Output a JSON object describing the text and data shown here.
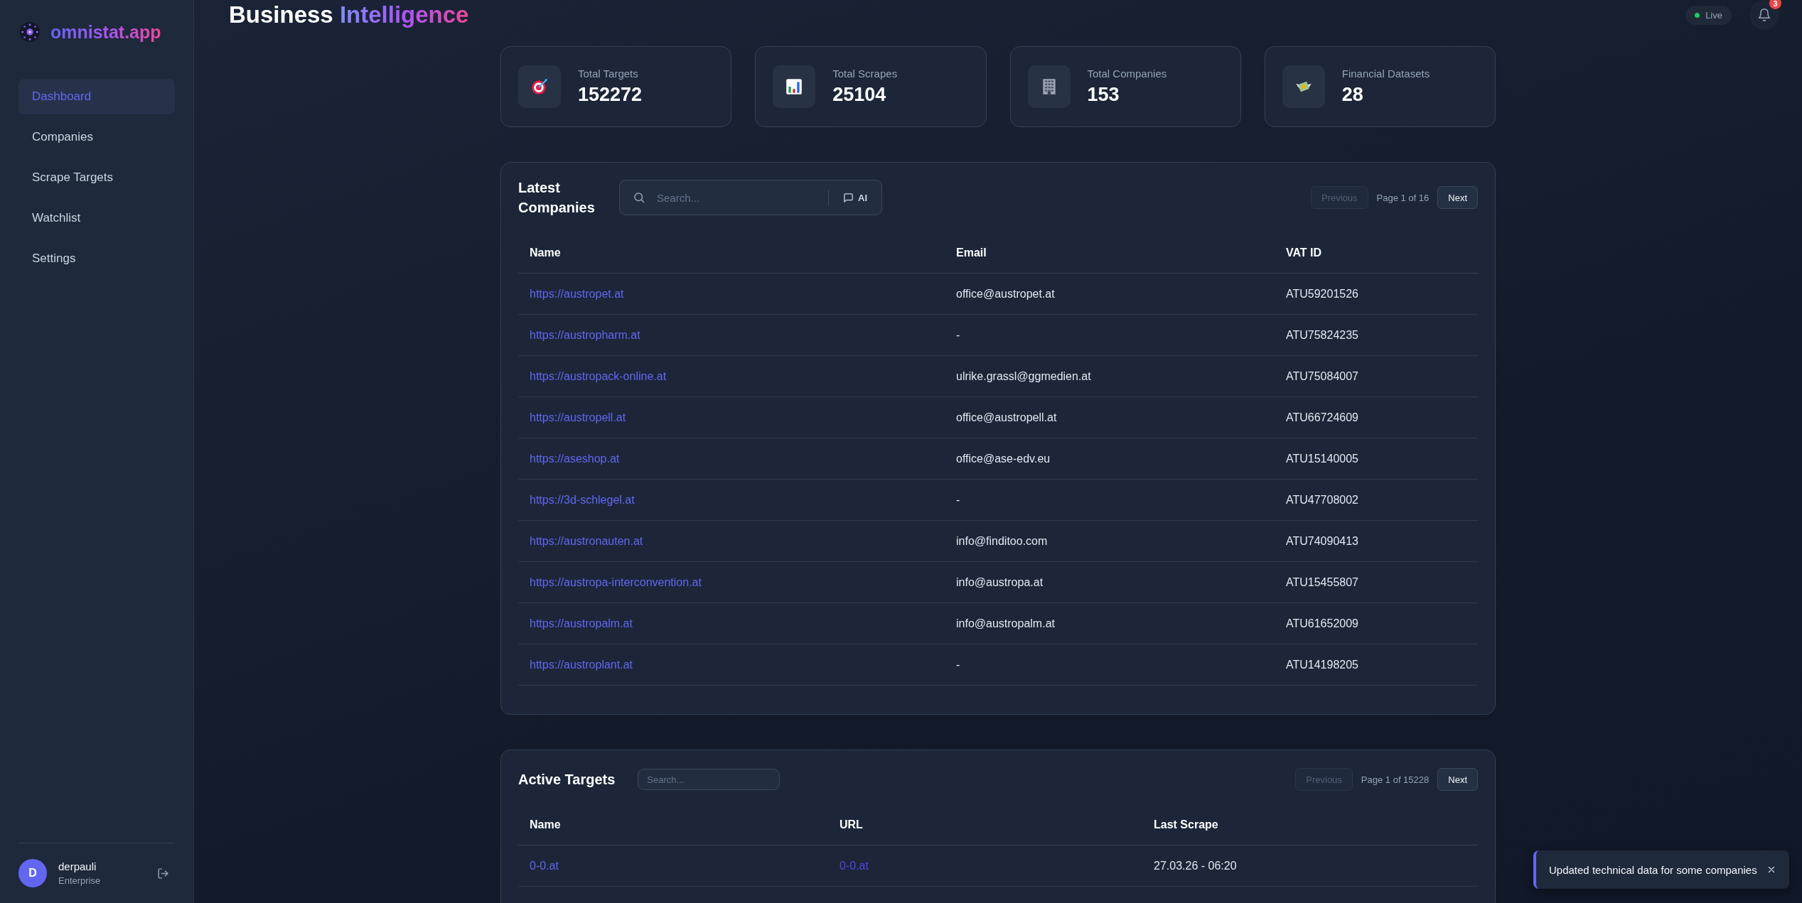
{
  "brand": {
    "name": "omnistat.app"
  },
  "nav": [
    {
      "label": "Dashboard",
      "selected": true
    },
    {
      "label": "Companies",
      "selected": false
    },
    {
      "label": "Scrape Targets",
      "selected": false
    },
    {
      "label": "Watchlist",
      "selected": false
    },
    {
      "label": "Settings",
      "selected": false
    }
  ],
  "user": {
    "initial": "D",
    "name": "derpauli",
    "plan": "Enterprise"
  },
  "header": {
    "title": "Business",
    "title_accent": "Intelligence",
    "status": "Live",
    "live": true,
    "notification_count": "3"
  },
  "stats": [
    {
      "kind": "target",
      "label": "Total Targets",
      "value": "152272"
    },
    {
      "kind": "chart",
      "label": "Total Scrapes",
      "value": "25104"
    },
    {
      "kind": "building",
      "label": "Total Companies",
      "value": "153"
    },
    {
      "kind": "money",
      "label": "Financial Datasets",
      "value": "28"
    }
  ],
  "companies": {
    "title": "Latest Companies",
    "search": {
      "placeholder": "Search..."
    },
    "ai_button": "AI",
    "pagination": {
      "previous": "Previous",
      "previous_disabled": true,
      "page": "Page 1 of 16",
      "next": "Next"
    },
    "columns": [
      "Name",
      "Email",
      "VAT ID"
    ],
    "rows": [
      {
        "name": "https://austropet.at",
        "email": "office@austropet.at",
        "vat_id": "ATU59201526"
      },
      {
        "name": "https://austropharm.at",
        "email": "-",
        "vat_id": "ATU75824235"
      },
      {
        "name": "https://austropack-online.at",
        "email": "ulrike.grassl@ggmedien.at",
        "vat_id": "ATU75084007"
      },
      {
        "name": "https://austropell.at",
        "email": "office@austropell.at",
        "vat_id": "ATU66724609"
      },
      {
        "name": "https://aseshop.at",
        "email": "office@ase-edv.eu",
        "vat_id": "ATU15140005"
      },
      {
        "name": "https://3d-schlegel.at",
        "email": "-",
        "vat_id": "ATU47708002"
      },
      {
        "name": "https://austronauten.at",
        "email": "info@finditoo.com",
        "vat_id": "ATU74090413"
      },
      {
        "name": "https://austropa-interconvention.at",
        "email": "info@austropa.at",
        "vat_id": "ATU15455807"
      },
      {
        "name": "https://austropalm.at",
        "email": "info@austropalm.at",
        "vat_id": "ATU61652009"
      },
      {
        "name": "https://austroplant.at",
        "email": "-",
        "vat_id": "ATU14198205"
      }
    ]
  },
  "targets": {
    "title": "Active Targets",
    "search": {
      "placeholder": "Search..."
    },
    "pagination": {
      "previous": "Previous",
      "previous_disabled": true,
      "page": "Page 1 of 15228",
      "next": "Next"
    },
    "columns": [
      "Name",
      "URL",
      "Last Scrape"
    ],
    "rows": [
      {
        "name": "0-0.at",
        "url": "0-0.at",
        "last_scrape": "27.03.26 - 06:20"
      }
    ]
  },
  "toast": {
    "message": "Updated technical data for some companies"
  }
}
